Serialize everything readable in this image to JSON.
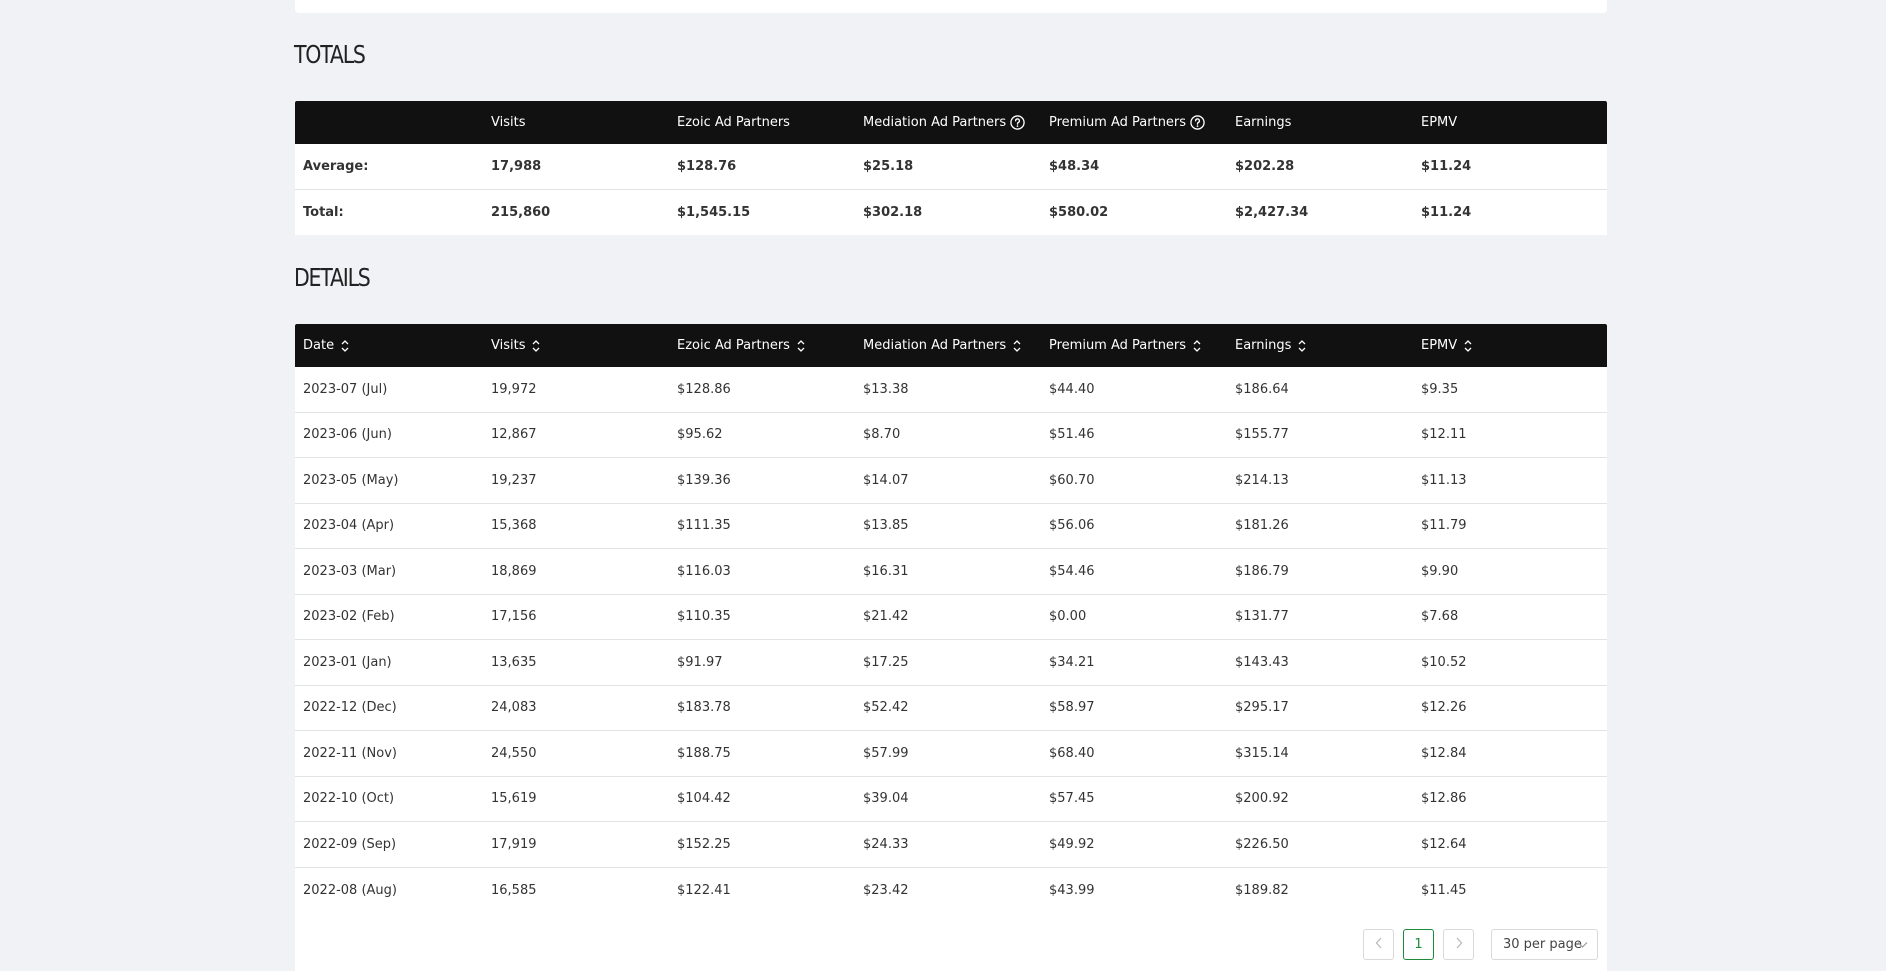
{
  "totals": {
    "title": "TOTALS",
    "headers": [
      "",
      "Visits",
      "Ezoic Ad Partners",
      "Mediation Ad Partners",
      "Premium Ad Partners",
      "Earnings",
      "EPMV"
    ],
    "rows": [
      [
        "Average:",
        "17,988",
        "$128.76",
        "$25.18",
        "$48.34",
        "$202.28",
        "$11.24"
      ],
      [
        "Total:",
        "215,860",
        "$1,545.15",
        "$302.18",
        "$580.02",
        "$2,427.34",
        "$11.24"
      ]
    ]
  },
  "details": {
    "title": "DETAILS",
    "headers": [
      "Date",
      "Visits",
      "Ezoic Ad Partners",
      "Mediation Ad Partners",
      "Premium Ad Partners",
      "Earnings",
      "EPMV"
    ],
    "rows": [
      [
        "2023-07 (Jul)",
        "19,972",
        "$128.86",
        "$13.38",
        "$44.40",
        "$186.64",
        "$9.35"
      ],
      [
        "2023-06 (Jun)",
        "12,867",
        "$95.62",
        "$8.70",
        "$51.46",
        "$155.77",
        "$12.11"
      ],
      [
        "2023-05 (May)",
        "19,237",
        "$139.36",
        "$14.07",
        "$60.70",
        "$214.13",
        "$11.13"
      ],
      [
        "2023-04 (Apr)",
        "15,368",
        "$111.35",
        "$13.85",
        "$56.06",
        "$181.26",
        "$11.79"
      ],
      [
        "2023-03 (Mar)",
        "18,869",
        "$116.03",
        "$16.31",
        "$54.46",
        "$186.79",
        "$9.90"
      ],
      [
        "2023-02 (Feb)",
        "17,156",
        "$110.35",
        "$21.42",
        "$0.00",
        "$131.77",
        "$7.68"
      ],
      [
        "2023-01 (Jan)",
        "13,635",
        "$91.97",
        "$17.25",
        "$34.21",
        "$143.43",
        "$10.52"
      ],
      [
        "2022-12 (Dec)",
        "24,083",
        "$183.78",
        "$52.42",
        "$58.97",
        "$295.17",
        "$12.26"
      ],
      [
        "2022-11 (Nov)",
        "24,550",
        "$188.75",
        "$57.99",
        "$68.40",
        "$315.14",
        "$12.84"
      ],
      [
        "2022-10 (Oct)",
        "15,619",
        "$104.42",
        "$39.04",
        "$57.45",
        "$200.92",
        "$12.86"
      ],
      [
        "2022-09 (Sep)",
        "17,919",
        "$152.25",
        "$24.33",
        "$49.92",
        "$226.50",
        "$12.64"
      ],
      [
        "2022-08 (Aug)",
        "16,585",
        "$122.41",
        "$23.42",
        "$43.99",
        "$189.82",
        "$11.45"
      ]
    ]
  },
  "pagination": {
    "prev_icon": "chevron-left-icon",
    "current_page": "1",
    "next_icon": "chevron-right-icon",
    "per_page": "30 per page"
  },
  "colors": {
    "header_bg": "#111111",
    "page_bg": "#f0f2f5",
    "active_page": "#1c8c3a"
  }
}
